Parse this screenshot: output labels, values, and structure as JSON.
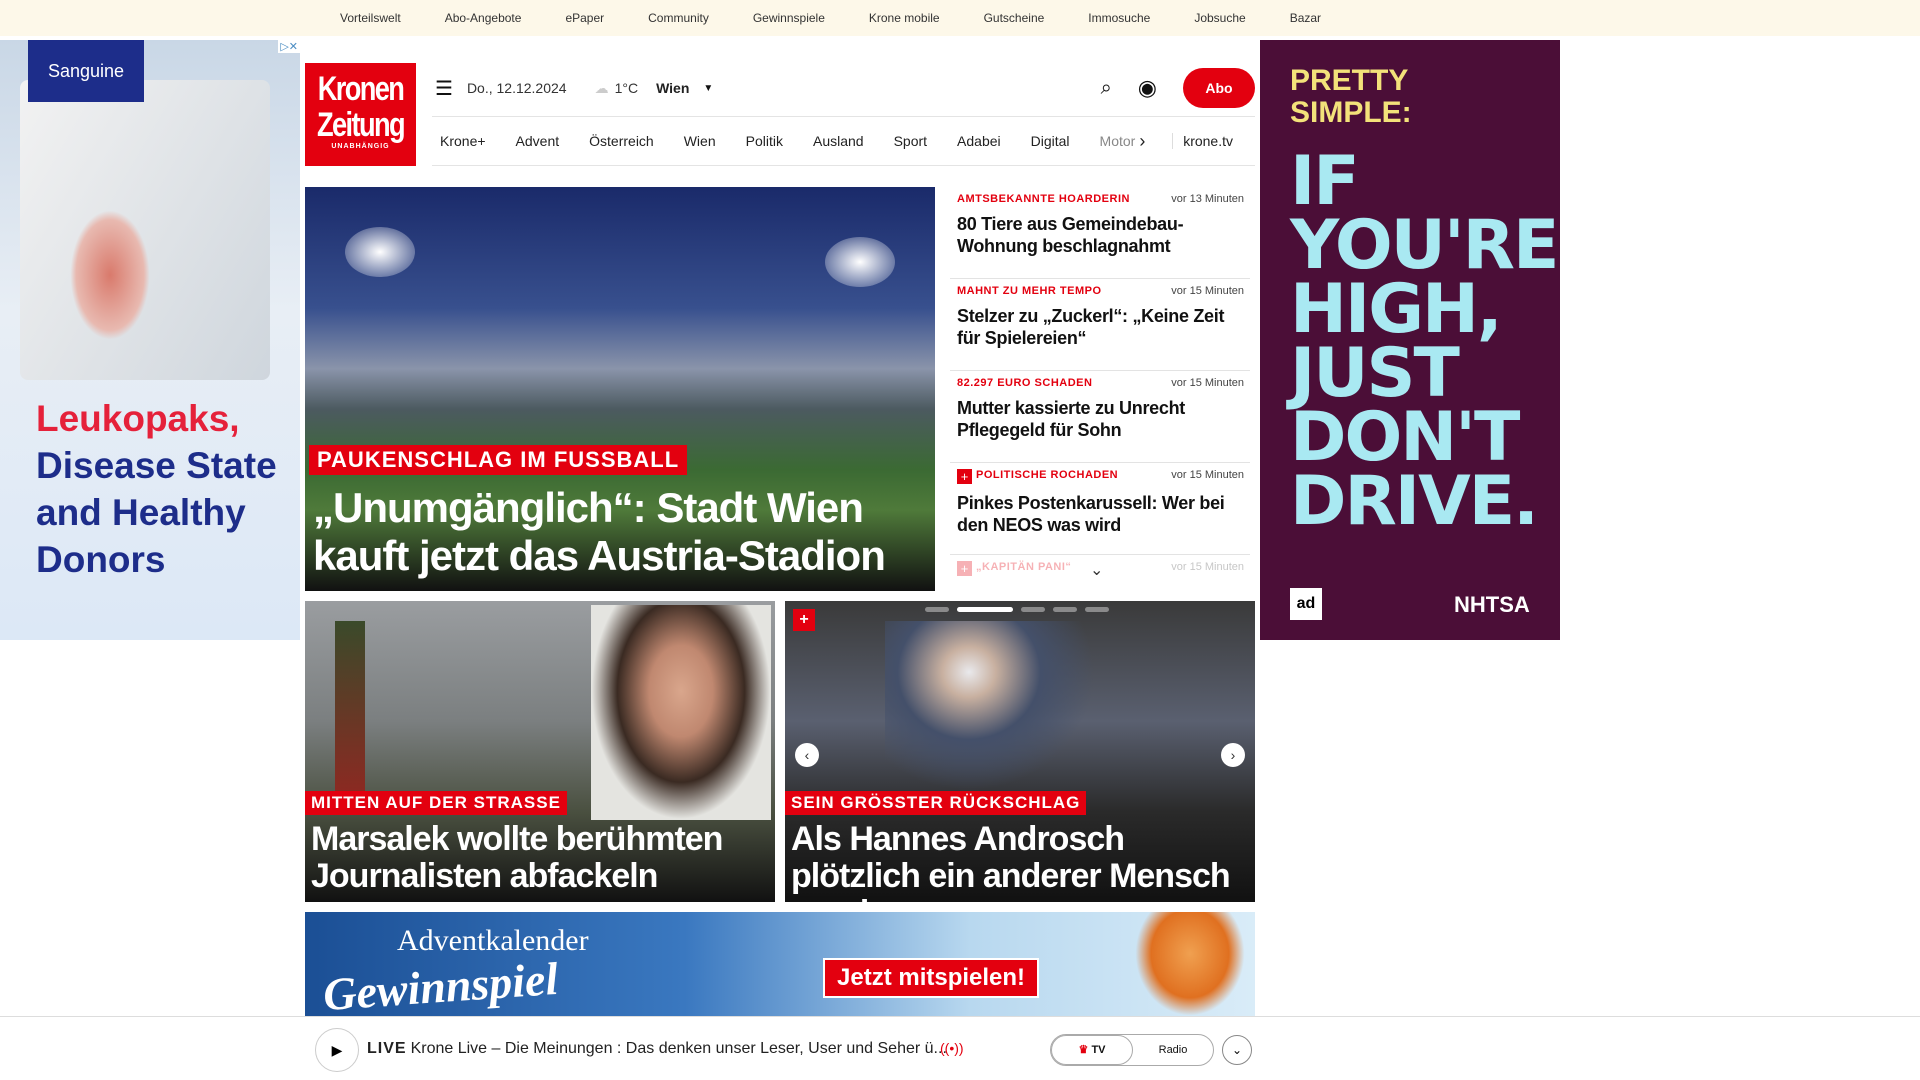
{
  "topnav": [
    "Vorteilswelt",
    "Abo-Angebote",
    "ePaper",
    "Community",
    "Gewinnspiele",
    "Krone mobile",
    "Gutscheine",
    "Immosuche",
    "Jobsuche",
    "Bazar"
  ],
  "ad_left": {
    "brand": "Sanguine",
    "line1": "Leukopaks,",
    "line2": "Disease State",
    "line3": "and Healthy",
    "line4": "Donors"
  },
  "ad_right": {
    "headline": "PRETTY SIMPLE:",
    "message": "IF YOU'RE HIGH, JUST DON'T DRIVE.",
    "logo1": "ad",
    "logo2": "NHTSA"
  },
  "logo": {
    "line1": "Kronen",
    "line2": "Zeitung",
    "line3": "UNABHÄNGIG"
  },
  "header": {
    "date": "Do., 12.12.2024",
    "temp": "1°C",
    "city": "Wien",
    "abo": "Abo"
  },
  "nav": [
    "Krone+",
    "Advent",
    "Österreich",
    "Wien",
    "Politik",
    "Ausland",
    "Sport",
    "Adabei",
    "Digital",
    "Motor"
  ],
  "nav_tv": "krone.tv",
  "hero": {
    "kicker": "PAUKENSCHLAG IM FUSSBALL",
    "title": "„Unumgänglich“: Stadt Wien kauft jetzt das Austria-Stadion"
  },
  "list": [
    {
      "kicker": "AMTSBEKANNTE HOARDERIN",
      "time": "vor 13 Minuten",
      "title": "80 Tiere aus Gemeindebau-Wohnung beschlagnahmt"
    },
    {
      "kicker": "MAHNT ZU MEHR TEMPO",
      "time": "vor 15 Minuten",
      "title": "Stelzer zu „Zuckerl“: „Keine Zeit für Spielereien“"
    },
    {
      "kicker": "82.297 EURO SCHADEN",
      "time": "vor 15 Minuten",
      "title": "Mutter kassierte zu Unrecht Pflegegeld für Sohn"
    },
    {
      "kicker": "POLITISCHE ROCHADEN",
      "time": "vor 15 Minuten",
      "title": "Pinkes Postenkarussell: Wer bei den NEOS was wird"
    },
    {
      "kicker": "„KAPITÄN PANI“",
      "time": "vor 15 Minuten",
      "title": ""
    }
  ],
  "cards": [
    {
      "kicker": "MITTEN AUF DER STRASSE",
      "title": "Marsalek wollte berühmten Journalisten abfackeln"
    },
    {
      "kicker": "SEIN GRÖSSTER RÜCKSCHLAG",
      "title": "Als Hannes Androsch plötzlich ein anderer Mensch wurde"
    }
  ],
  "banner": {
    "line1": "Adventkalender",
    "line2": "Gewinnspiel",
    "cta": "Jetzt mitspielen!"
  },
  "live": {
    "label": "LIVE",
    "text": "Krone Live – Die Meinungen : Das denken unser Leser, User und Seher ü...",
    "tv": "TV",
    "radio": "Radio"
  }
}
